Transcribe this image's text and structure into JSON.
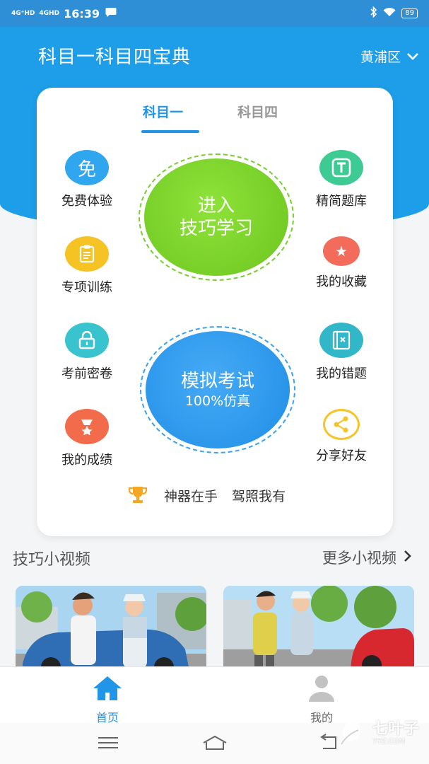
{
  "status_bar": {
    "signal_1": "4G⁺HD",
    "signal_2": "4GHD",
    "time": "16:39",
    "battery": "89"
  },
  "header": {
    "title": "科目一科目四宝典",
    "district": "黄浦区"
  },
  "tabs": [
    {
      "label": "科目一",
      "active": true
    },
    {
      "label": "科目四",
      "active": false
    }
  ],
  "features_left": [
    {
      "label": "免费体验",
      "icon": "free-icon",
      "glyph": "免",
      "color": "#2fa6ee"
    },
    {
      "label": "专项训练",
      "icon": "clipboard-icon",
      "glyph": "",
      "color": "#f6c324"
    },
    {
      "label": "考前密卷",
      "icon": "lock-icon",
      "glyph": "",
      "color": "#38c3cf"
    },
    {
      "label": "我的成绩",
      "icon": "medal-icon",
      "glyph": "",
      "color": "#f26b4b"
    }
  ],
  "features_right": [
    {
      "label": "精简题库",
      "icon": "question-bank-icon",
      "glyph": "T",
      "color": "#3ecb93"
    },
    {
      "label": "我的收藏",
      "icon": "star-icon",
      "glyph": "★",
      "color": "#f26b5b"
    },
    {
      "label": "我的错题",
      "icon": "wrong-book-icon",
      "glyph": "",
      "color": "#32b7c9"
    },
    {
      "label": "分享好友",
      "icon": "share-icon",
      "glyph": "",
      "color": "#f5c527"
    }
  ],
  "study_button": {
    "line1": "进入",
    "line2": "技巧学习"
  },
  "exam_button": {
    "line1": "模拟考试",
    "line2": "100%仿真"
  },
  "slogan": {
    "part1": "神器在手",
    "part2": "驾照我有"
  },
  "videos": {
    "title": "技巧小视频",
    "more": "更多小视频"
  },
  "bottom_tabs": [
    {
      "label": "首页",
      "active": true
    },
    {
      "label": "我的",
      "active": false
    }
  ],
  "watermark": {
    "text": "七叶子",
    "sub": "7YZ.COM"
  },
  "colors": {
    "primary": "#2196e8",
    "header": "#1e9ee8",
    "green": "#6cc51e"
  }
}
